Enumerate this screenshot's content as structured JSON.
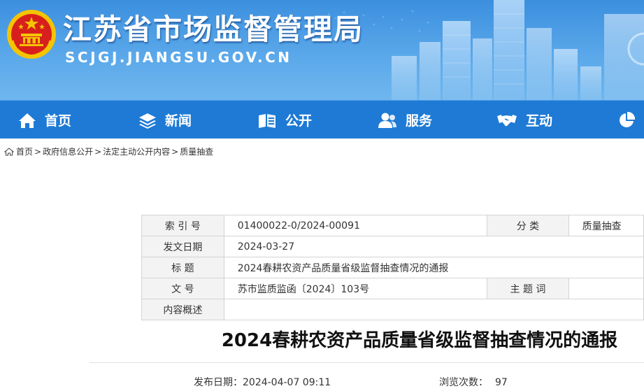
{
  "header": {
    "site_title": "江苏省市场监督管理局",
    "site_url": "SCJGJ.JIANGSU.GOV.CN"
  },
  "nav": {
    "items": [
      {
        "label": "首页",
        "icon": "home-icon"
      },
      {
        "label": "新闻",
        "icon": "layers-icon"
      },
      {
        "label": "公开",
        "icon": "open-book-icon"
      },
      {
        "label": "服务",
        "icon": "users-icon"
      },
      {
        "label": "互动",
        "icon": "handshake-icon"
      },
      {
        "label": "",
        "icon": "pie-chart-icon"
      }
    ]
  },
  "breadcrumb": {
    "items": [
      "首页",
      "政府信息公开",
      "法定主动公开内容",
      "质量抽查"
    ],
    "separator": ">"
  },
  "meta": {
    "index_label": "索 引 号",
    "index_value": "01400022-0/2024-00091",
    "category_label": "分 类",
    "category_value": "质量抽查",
    "date_label": "发文日期",
    "date_value": "2024-03-27",
    "title_label": "标 题",
    "title_value": "2024春耕农资产品质量省级监督抽查情况的通报",
    "docno_label": "文 号",
    "docno_value": "苏市监质监函〔2024〕103号",
    "subject_label": "主 题 词",
    "subject_value": "",
    "summary_label": "内容概述",
    "summary_value": ""
  },
  "article": {
    "title": "2024春耕农资产品质量省级监督抽查情况的通报",
    "publish_label": "发布日期：",
    "publish_value": "2024-04-07 09:11",
    "views_label": "浏览次数：",
    "views_value": "97"
  },
  "colors": {
    "nav_bg": "#1e7ad5",
    "banner": "#4d9fe6",
    "emblem_red": "#d7201d",
    "emblem_gold": "#f5c400"
  }
}
